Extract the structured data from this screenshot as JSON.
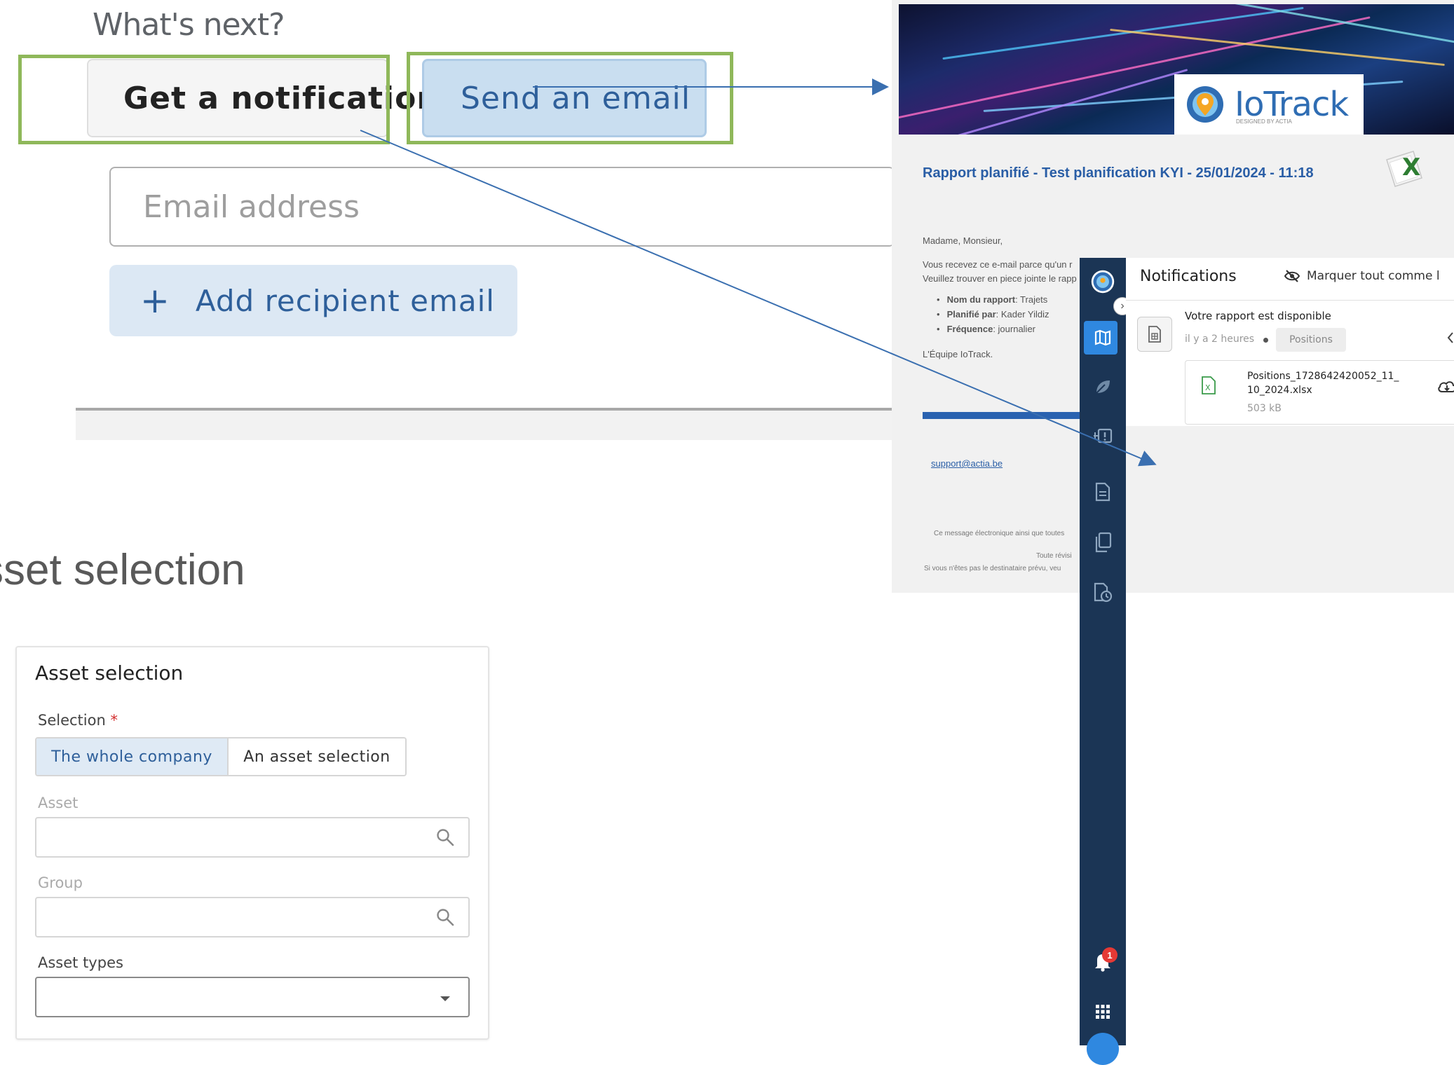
{
  "whats_next": {
    "heading": "What's next?",
    "get_notification_label": "Get a notification",
    "send_email_label": "Send an email",
    "email_placeholder": "Email address",
    "add_recipient_label": "Add recipient email",
    "add_recipient_icon": "plus-icon"
  },
  "asset_section_heading": "sset selection",
  "asset_card": {
    "title": "Asset selection",
    "selection_label": "Selection",
    "required_marker": "*",
    "options": [
      "The whole company",
      "An asset selection"
    ],
    "selected_option": "The whole company",
    "asset_label": "Asset",
    "group_label": "Group",
    "asset_types_label": "Asset types"
  },
  "email_preview": {
    "logo_text": "IoTrack",
    "logo_sub": "DESIGNED BY ACTIA",
    "report_title": "Rapport planifié - Test planification KYI - 25/01/2024 - 11:18",
    "greeting": "Madame, Monsieur,",
    "body_line1": "Vous recevez ce e-mail parce qu'un r",
    "body_line2": "Veuillez trouver en piece jointe le rapp",
    "list": [
      {
        "key": "Nom du rapport",
        "value": ": Trajets"
      },
      {
        "key": "Planifié par",
        "value": ": Kader Yildiz"
      },
      {
        "key": "Fréquence",
        "value": ": journalier"
      }
    ],
    "signature": "L'Équipe IoTrack.",
    "support_link": "support@actia.be",
    "footer_1": "Ce message électronique ainsi que toutes",
    "footer_2": "Toute révisi",
    "footer_3": "Si vous n'êtes pas le destinataire prévu, veu",
    "accent_color": "#2a62b0"
  },
  "sidebar": {
    "badge_count": "1",
    "color": "#1b3555",
    "active_color": "#2f88e0",
    "expand_glyph": "›"
  },
  "notifications": {
    "title": "Notifications",
    "mark_all_label": "Marquer tout comme l",
    "message": "Votre rapport est disponible",
    "time": "il y a 2 heures",
    "tag": "Positions",
    "file_name_line1": "Positions_1728642420052_11_",
    "file_name_line2": "10_2024.xlsx",
    "file_size": "503 kB"
  },
  "colors": {
    "highlight_green": "#8fb85a",
    "arrow_blue": "#3a6fb0"
  }
}
